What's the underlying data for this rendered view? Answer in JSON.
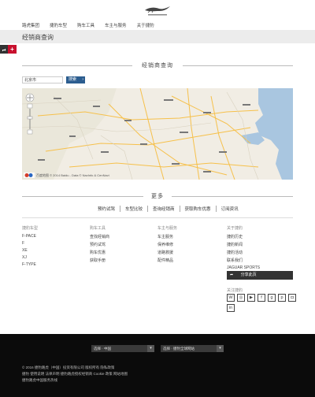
{
  "nav": {
    "items": [
      "路虎集团",
      "捷豹车型",
      "购车工具",
      "车主与服务",
      "关于捷豹"
    ]
  },
  "page": {
    "title": "经销商查询"
  },
  "side_tabs": {
    "share_icon": "share-icon",
    "add_icon": "plus-icon",
    "add_label": "+"
  },
  "section": {
    "title": "经销商查询"
  },
  "search": {
    "province_value": "北京市",
    "button_label": "搜索"
  },
  "map": {
    "footer_text": "© 2014 Baidu - Data © NavInfo & CenNavi",
    "logo_text": "百度地图"
  },
  "more": {
    "title": "更多",
    "links": [
      "预约试驾",
      "车型比较",
      "查询经销商",
      "获取购车优惠",
      "订阅资讯"
    ]
  },
  "footer_cols": [
    {
      "title": "捷豹车型",
      "items": [
        "F-PACE",
        "F",
        "XE",
        "XJ",
        "F-TYPE"
      ]
    },
    {
      "title": "购车工具",
      "items": [
        "查找经销商",
        "预约试驾",
        "购车优惠",
        "获取手册"
      ]
    },
    {
      "title": "车主与服务",
      "items": [
        "车主服务",
        "保养维修",
        "道路救援",
        "配件精品"
      ]
    },
    {
      "title": "关于捷豹",
      "items": [
        "捷豹历史",
        "捷豹新闻",
        "捷豹活动",
        "联系我们",
        "JAGUAR SPORTS"
      ]
    }
  ],
  "share": {
    "label": "分享此页"
  },
  "social": {
    "title": "关注捷豹",
    "icons": [
      "weibo-icon",
      "wechat-icon",
      "youku-icon",
      "facebook-icon",
      "googleplus-icon",
      "pinterest-icon",
      "instagram-icon",
      "linkedin-icon"
    ]
  },
  "footer": {
    "select_country": "选择 · 中国",
    "select_region": "选择 · 捷豹全球网站",
    "lines": [
      "© 2016 捷豹路虎（中国）投资有限公司 版权所有  隐私政策",
      "捷豹 使用说明 法律声明 捷豹路虎授权经销商 Cookie 政策 网站地图",
      "捷豹路虎中国服务热线"
    ]
  }
}
